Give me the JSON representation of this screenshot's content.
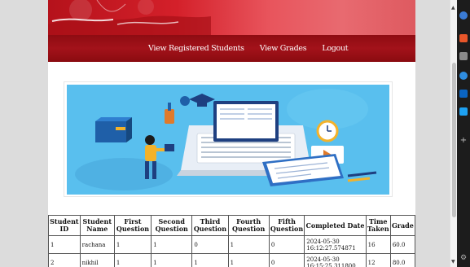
{
  "nav": {
    "links": [
      "View Registered Students",
      "View Grades",
      "Logout"
    ]
  },
  "table": {
    "headers": [
      "Student ID",
      "Student Name",
      "First Question",
      "Second Question",
      "Third Question",
      "Fourth Question",
      "Fifth Question",
      "Completed Date",
      "Time Taken",
      "Grade"
    ],
    "rows": [
      [
        "1",
        "rachana",
        "1",
        "1",
        "0",
        "1",
        "0",
        "2024-05-30 16:12:27.574871",
        "16",
        "60.0"
      ],
      [
        "2",
        "nikhil",
        "1",
        "1",
        "1",
        "1",
        "0",
        "2024-05-30 16:15:25.311800",
        "12",
        "80.0"
      ]
    ]
  },
  "colors": {
    "banner": "#d4202a",
    "navbar": "#a3121a",
    "hero_background": "#59bfee"
  },
  "icons": {
    "sidepanel": [
      "app-icon",
      "shopping-icon",
      "puzzle-icon",
      "circle-icon",
      "outlook-icon",
      "send-icon",
      "add-icon",
      "settings-icon"
    ]
  }
}
